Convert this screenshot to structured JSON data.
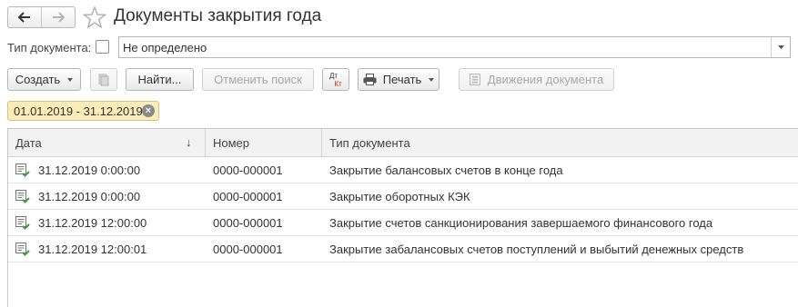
{
  "window": {
    "title": "Документы закрытия года",
    "back_icon": "arrow-left-icon",
    "forward_icon": "arrow-right-icon",
    "favorite_icon": "star-outline-icon"
  },
  "filter": {
    "doc_type_label": "Тип документа:",
    "doc_type_checked": false,
    "doc_type_value": "Не определено"
  },
  "toolbar": {
    "create_label": "Создать",
    "find_label": "Найти...",
    "cancel_search_label": "Отменить поиск",
    "dt_kt_top": "Дт",
    "dt_kt_bottom": "Кт",
    "print_label": "Печать",
    "movements_label": "Движения документа"
  },
  "period": {
    "label": "01.01.2019 - 31.12.2019",
    "clear_icon": "clear-icon"
  },
  "table": {
    "columns": [
      "Дата",
      "Номер",
      "Тип документа"
    ],
    "sort_indicator": "↓",
    "rows": [
      {
        "date": "31.12.2019 0:00:00",
        "number": "0000-000001",
        "type": "Закрытие балансовых счетов в конце года"
      },
      {
        "date": "31.12.2019 0:00:00",
        "number": "0000-000001",
        "type": "Закрытие оборотных КЭК"
      },
      {
        "date": "31.12.2019 12:00:00",
        "number": "0000-000001",
        "type": "Закрытие счетов санкционирования завершаемого финансового года"
      },
      {
        "date": "31.12.2019 12:00:01",
        "number": "0000-000001",
        "type": "Закрытие забалансовых счетов поступлений и выбытий денежных средств"
      }
    ]
  },
  "colors": {
    "accent_green": "#3a9a3a",
    "tag_background": "#fbecb8",
    "header_background": "#f2f2f2"
  }
}
